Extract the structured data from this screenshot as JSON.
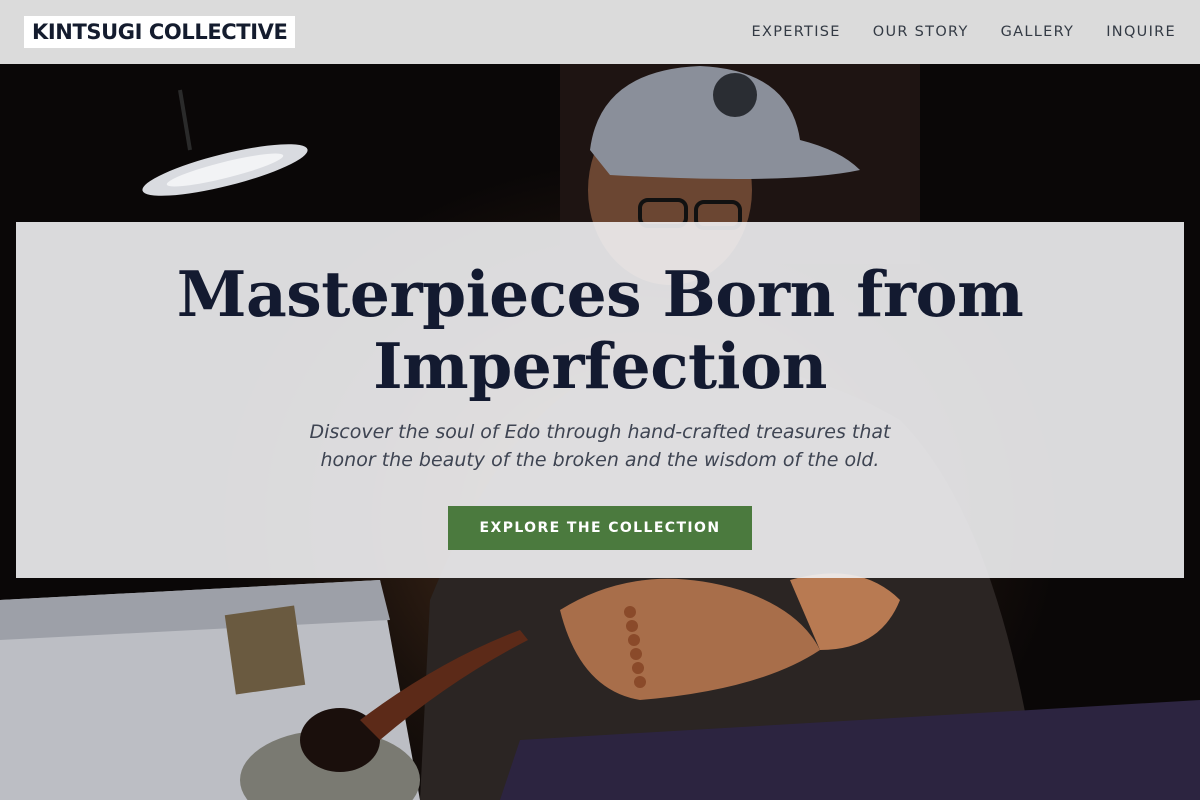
{
  "brand": {
    "name": "KINTSUGI COLLECTIVE"
  },
  "nav": {
    "items": [
      {
        "label": "EXPERTISE"
      },
      {
        "label": "OUR STORY"
      },
      {
        "label": "GALLERY"
      },
      {
        "label": "INQUIRE"
      }
    ]
  },
  "hero": {
    "title_line1": "Masterpieces Born from",
    "title_line2": "Imperfection",
    "subtitle": "Discover the soul of Edo through hand-crafted treasures that honor the beauty of the broken and the wisdom of the old.",
    "cta_label": "EXPLORE THE COLLECTION"
  },
  "colors": {
    "navy": "#131a30",
    "accent_green": "#4b7a3e",
    "nav_bg": "#ececec"
  }
}
